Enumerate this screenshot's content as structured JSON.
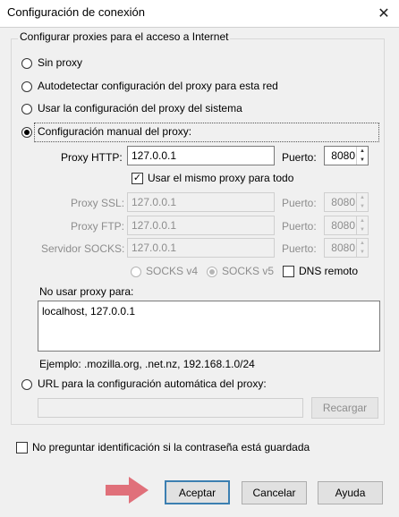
{
  "window": {
    "title": "Configuración de conexión",
    "close_glyph": "✕"
  },
  "group": {
    "legend": "Configurar proxies para el acceso a Internet"
  },
  "options": {
    "no_proxy": "Sin proxy",
    "auto_detect": "Autodetectar configuración del proxy para esta red",
    "system": "Usar la configuración del proxy del sistema",
    "manual": "Configuración manual del proxy:",
    "auto_url": "URL para la configuración automática del proxy:"
  },
  "manual": {
    "http_label": "Proxy HTTP:",
    "http_value": "127.0.0.1",
    "port_label": "Puerto:",
    "http_port": "8080",
    "same_proxy_label": "Usar el mismo proxy para todo",
    "same_proxy_checked": true,
    "ssl_label": "Proxy SSL:",
    "ssl_value": "127.0.0.1",
    "ssl_port": "8080",
    "ftp_label": "Proxy FTP:",
    "ftp_value": "127.0.0.1",
    "ftp_port": "8080",
    "socks_label": "Servidor SOCKS:",
    "socks_value": "127.0.0.1",
    "socks_port": "8080",
    "socks_v4": "SOCKS v4",
    "socks_v5": "SOCKS v5",
    "dns_remote": "DNS remoto",
    "no_proxy_label": "No usar proxy para:",
    "no_proxy_value": "localhost, 127.0.0.1",
    "example": "Ejemplo: .mozilla.org, .net.nz, 192.168.1.0/24"
  },
  "auto_url": {
    "value": "",
    "reload_label": "Recargar"
  },
  "no_prompt_auth": "No preguntar identificación si la contraseña está guardada",
  "buttons": {
    "accept": "Aceptar",
    "cancel": "Cancelar",
    "help": "Ayuda"
  },
  "colors": {
    "arrow": "#e0707a",
    "default_button_border": "#3c7fb1",
    "dialog_bg": "#f0f0f0"
  },
  "icons": {
    "close": "close-icon",
    "arrow": "right-arrow-icon",
    "check": "checkmark-icon"
  }
}
